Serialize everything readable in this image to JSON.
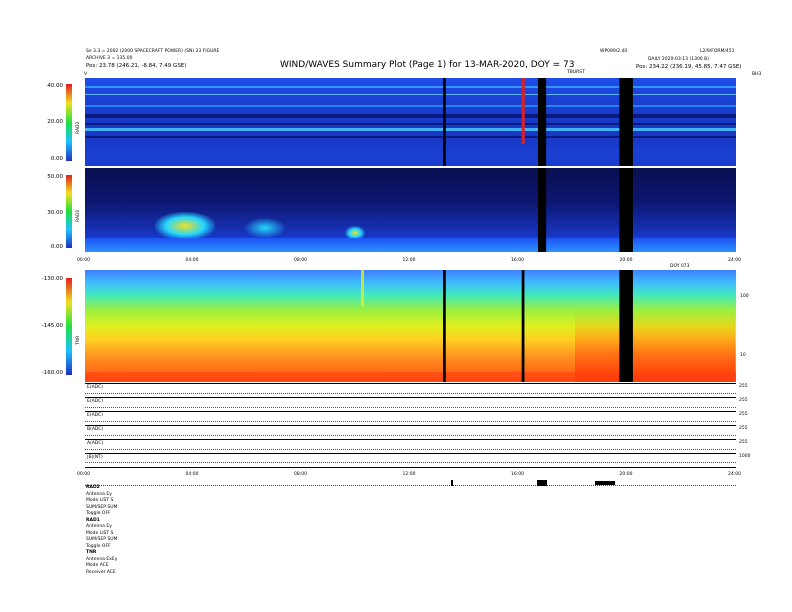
{
  "header": {
    "title": "WIND/WAVES Summary Plot (Page 1) for 13-MAR-2020, DOY = 73",
    "left_line1": "Se 3.3 = 2002 (2000 SPACECRAFT POWER) (SN) 23 FIGURE",
    "left_line2": "ARCHIVE 3 = 135.00",
    "left_pos": "Pos: 23.78 (246.21, -8.84, 7.49 GSE)",
    "right_center": "WP099/2.40",
    "right_far": "L2/9/FORM/451",
    "right_line2": "DAILY 2020-03-13 (1300 B)",
    "right_pos": "Pos: 234.22 (236.19, 45.85, 7.47 GSE)",
    "tbursts": "TBURST",
    "top_left_v": "V",
    "top_right_lbl": "BH3"
  },
  "panels": {
    "rad2": {
      "label": "RAD2",
      "yticks": [
        "40.00",
        "20.00",
        "0.00"
      ]
    },
    "rad1": {
      "label": "RAD1",
      "yticks": [
        "50.00",
        "30.00",
        "0.00"
      ]
    },
    "tnr": {
      "label": "TNR",
      "yticks": [
        "-130.00",
        "-145.00",
        "-160.00"
      ],
      "right_ticks": [
        "100",
        "10"
      ]
    }
  },
  "time_axis_top": [
    "00:00",
    "04:00",
    "08:00",
    "12:00",
    "16:00",
    "20:00",
    "24:00"
  ],
  "time_axis_bottom": [
    "00:00",
    "04:00",
    "08:00",
    "12:00",
    "16:00",
    "20:00",
    "24:00"
  ],
  "date_tag": "DOY 073",
  "lines": [
    {
      "label": "E(ADC)",
      "right": "255"
    },
    {
      "label": "E(ADC)",
      "right": "255"
    },
    {
      "label": "E(ADC)",
      "right": "255"
    },
    {
      "label": "B(ADC)",
      "right": "255"
    },
    {
      "label": "A(ADC)",
      "right": "255"
    },
    {
      "label": "|B|(NT)",
      "right": "1000"
    }
  ],
  "status_left": {
    "rad2_head": "RAD2",
    "rad2_lines": [
      "Antenna  Ey",
      "Mode  LIST S",
      "SUM/SEP  SUM",
      "Toggle  OFF"
    ],
    "rad1_head": "RAD1",
    "rad1_lines": [
      "Antenna  Ey",
      "Mode  LIST S",
      "SUM/SEP  SUM",
      "Toggle  OFF"
    ],
    "tnr_head": "TNR",
    "tnr_lines": [
      "Antenna  ExEy",
      "Mode  ACE",
      "Receiver  ACE"
    ]
  },
  "chart_data": [
    {
      "type": "heatmap",
      "title": "RAD2",
      "ylabel": "RAD2",
      "ylim": [
        0,
        40
      ],
      "x_range_hours": [
        0,
        24
      ],
      "colors": [
        "#1a2bb0",
        "#1f57ff",
        "#2fa0ff",
        "#25d8ff",
        "#f02020"
      ],
      "features": [
        {
          "kind": "data_gap",
          "start_hour": 13.2,
          "end_hour": 13.3
        },
        {
          "kind": "burst",
          "hour": 16.1,
          "color": "#e02020"
        },
        {
          "kind": "data_gap",
          "start_hour": 16.7,
          "end_hour": 17.0
        },
        {
          "kind": "data_gap",
          "start_hour": 19.7,
          "end_hour": 20.2
        }
      ]
    },
    {
      "type": "heatmap",
      "title": "RAD1",
      "ylabel": "RAD1",
      "ylim": [
        0,
        50
      ],
      "x_range_hours": [
        0,
        24
      ],
      "features": [
        {
          "kind": "enhancement",
          "start_hour": 3.0,
          "end_hour": 4.5
        },
        {
          "kind": "enhancement",
          "start_hour": 6.0,
          "end_hour": 7.0
        },
        {
          "kind": "enhancement",
          "start_hour": 10.0,
          "end_hour": 10.5
        },
        {
          "kind": "data_gap",
          "start_hour": 16.7,
          "end_hour": 17.0
        },
        {
          "kind": "data_gap",
          "start_hour": 19.7,
          "end_hour": 20.2
        }
      ]
    },
    {
      "type": "heatmap",
      "title": "TNR",
      "ylabel": "TNR",
      "ylim": [
        -160,
        -130
      ],
      "x_range_hours": [
        0,
        24
      ],
      "features": [
        {
          "kind": "data_gap",
          "start_hour": 13.2,
          "end_hour": 13.3
        },
        {
          "kind": "data_gap",
          "start_hour": 16.1,
          "end_hour": 16.2
        },
        {
          "kind": "data_gap",
          "start_hour": 19.7,
          "end_hour": 20.2
        }
      ]
    }
  ]
}
